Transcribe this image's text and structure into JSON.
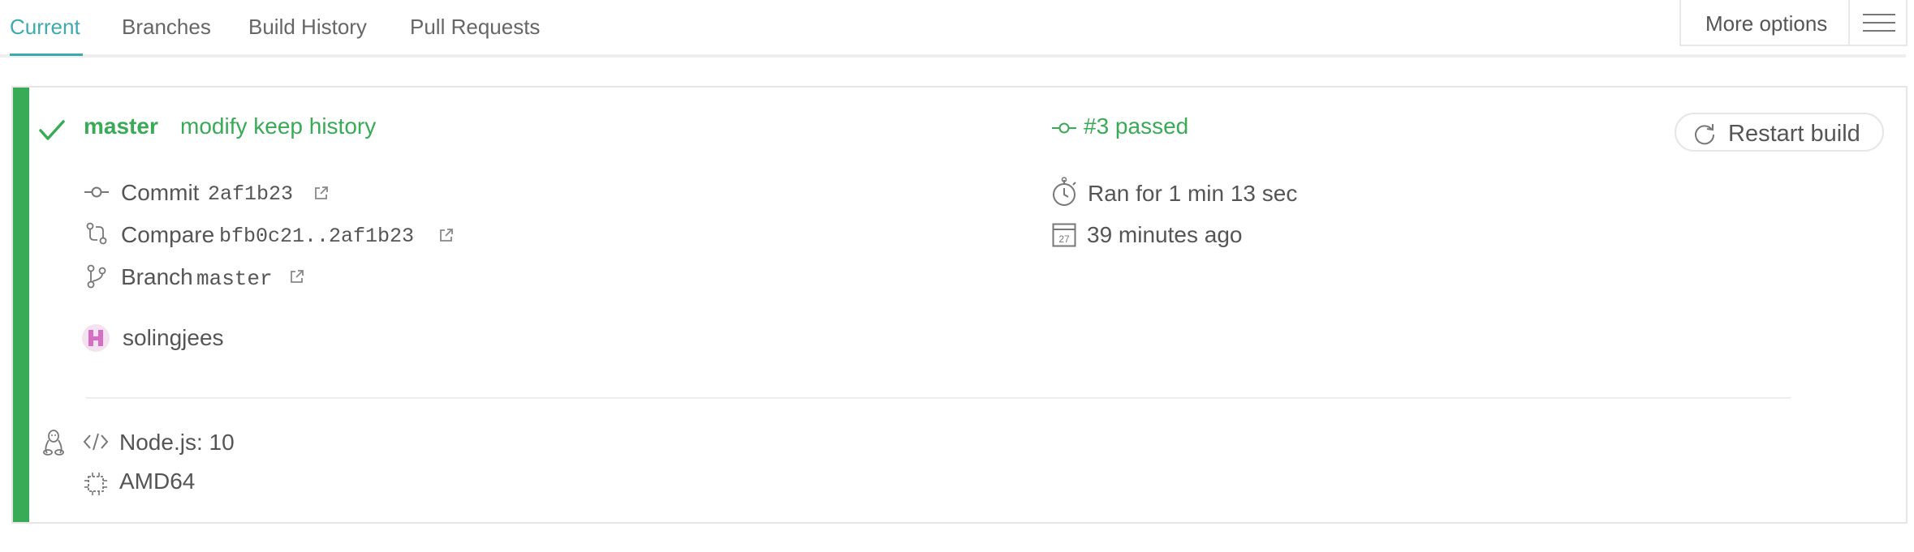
{
  "tabs": [
    {
      "label": "Current",
      "active": true
    },
    {
      "label": "Branches",
      "active": false
    },
    {
      "label": "Build History",
      "active": false
    },
    {
      "label": "Pull Requests",
      "active": false
    }
  ],
  "more_options": {
    "label": "More options",
    "icon": "hamburger-menu-icon"
  },
  "build": {
    "status_color": "#39aa56",
    "branch": "master",
    "message": "modify keep history",
    "number_status": "#3 passed",
    "restart_label": "Restart build",
    "commit": {
      "label": "Commit",
      "value": "2af1b23"
    },
    "compare": {
      "label": "Compare",
      "value": "bfb0c21..2af1b23"
    },
    "branch_info": {
      "label": "Branch",
      "value": "master"
    },
    "author": "solingjees",
    "duration": "Ran for 1 min 13 sec",
    "finished": "39 minutes ago",
    "calendar_day": "27",
    "language": "Node.js: 10",
    "arch": "AMD64"
  },
  "colors": {
    "accent": "#3eaaaf",
    "passed": "#39aa56"
  }
}
